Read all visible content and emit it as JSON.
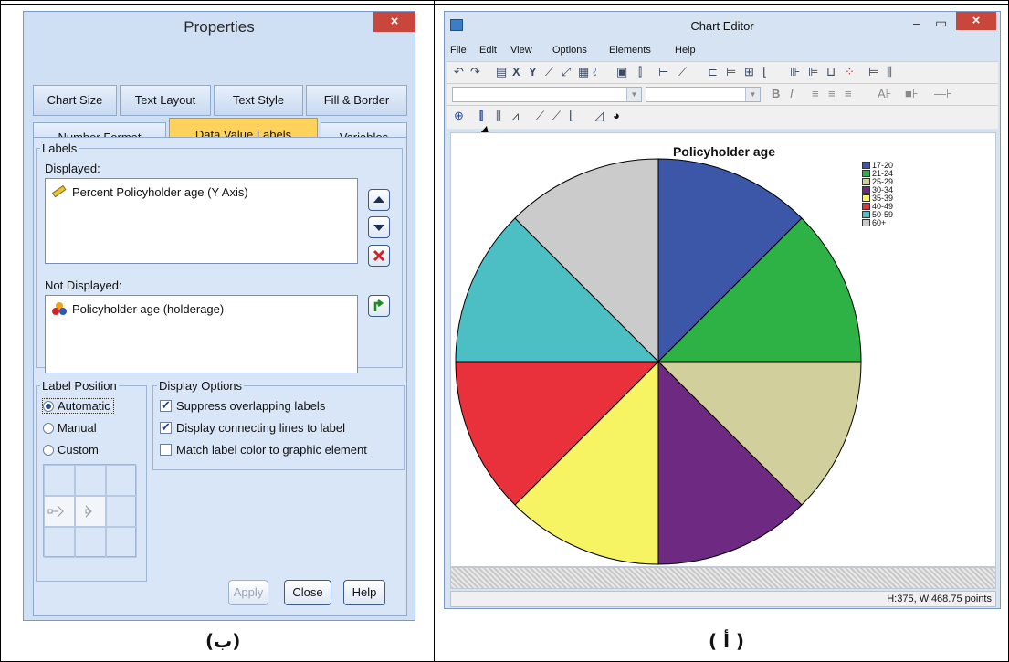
{
  "captions": {
    "right": "( أ )",
    "left": "(ب)"
  },
  "properties": {
    "title": "Properties",
    "close_glyph": "×",
    "tabs_row1": [
      "Chart Size",
      "Text Layout",
      "Text Style",
      "Fill & Border"
    ],
    "tabs_row2": [
      "Number Format",
      "Data Value Labels",
      "Variables"
    ],
    "active_tab": "Data Value Labels",
    "labels_group": "Labels",
    "displayed_label": "Displayed:",
    "displayed_items": [
      "Percent Policyholder age (Y Axis)"
    ],
    "not_displayed_label": "Not Displayed:",
    "not_displayed_items": [
      "Policyholder age (holderage)"
    ],
    "label_position": {
      "title": "Label Position",
      "options": [
        "Automatic",
        "Manual",
        "Custom"
      ],
      "selected": "Automatic"
    },
    "display_options": {
      "title": "Display Options",
      "items": [
        {
          "label": "Suppress overlapping labels",
          "checked": true
        },
        {
          "label": "Display connecting lines to label",
          "checked": true
        },
        {
          "label": "Match label color to graphic element",
          "checked": false
        }
      ]
    },
    "buttons": {
      "apply": "Apply",
      "close": "Close",
      "help": "Help"
    }
  },
  "chart_editor": {
    "title": "Chart Editor",
    "menus": [
      "File",
      "Edit",
      "View",
      "Options",
      "Elements",
      "Help"
    ],
    "status_text": "H:375, W:468.75 points",
    "chart_data": {
      "type": "pie",
      "title": "Policyholder age",
      "categories": [
        "17-20",
        "21-24",
        "25-29",
        "30-34",
        "35-39",
        "40-49",
        "50-59",
        "60+"
      ],
      "values": [
        12.5,
        12.5,
        12.5,
        12.5,
        12.5,
        12.5,
        12.5,
        12.5
      ],
      "colors": [
        "#3c57a8",
        "#2fb245",
        "#d1cf9c",
        "#6e2a82",
        "#f6f463",
        "#e8313a",
        "#4bbfc3",
        "#cbcbcb"
      ],
      "legend_position": "top-right",
      "start_angle": "top",
      "direction": "clockwise"
    }
  }
}
